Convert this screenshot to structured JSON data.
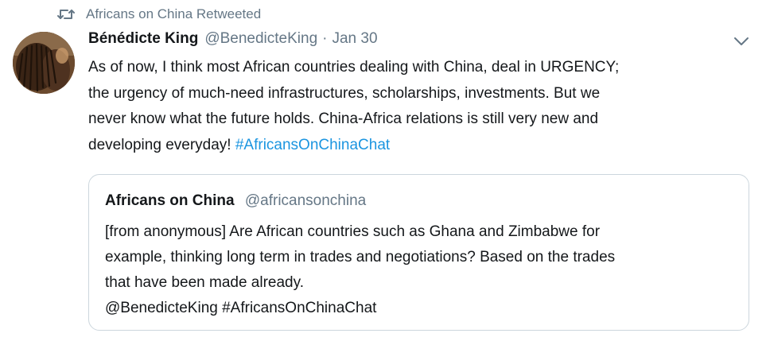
{
  "retweet_context": {
    "icon": "retweet-icon",
    "label": "Africans on China Retweeted"
  },
  "tweet": {
    "author_name": "Bénédicte King",
    "author_handle": "@BenedicteKing",
    "separator": "·",
    "date": "Jan 30",
    "menu_icon": "chevron-down-icon",
    "text_lines": [
      "As of now, I think most African countries dealing with China, deal in URGENCY;",
      "the urgency of much-need infrastructures, scholarships, investments. But  we",
      "never know what the future holds. China-Africa relations is still very new and"
    ],
    "last_line_text": "developing everyday! ",
    "hashtag": "#AfricansOnChinaChat"
  },
  "quoted_tweet": {
    "author_name": "Africans on China",
    "author_handle": "@africansonchina",
    "text_lines": [
      "[from anonymous] Are African countries such as Ghana and Zimbabwe for",
      "example, thinking long term in trades and negotiations? Based on the trades",
      "that have been made already.",
      "@BenedicteKing #AfricansOnChinaChat"
    ]
  },
  "colors": {
    "text_primary": "#14171a",
    "text_secondary": "#657786",
    "link": "#1b95e0",
    "border": "#ccd6dd"
  }
}
